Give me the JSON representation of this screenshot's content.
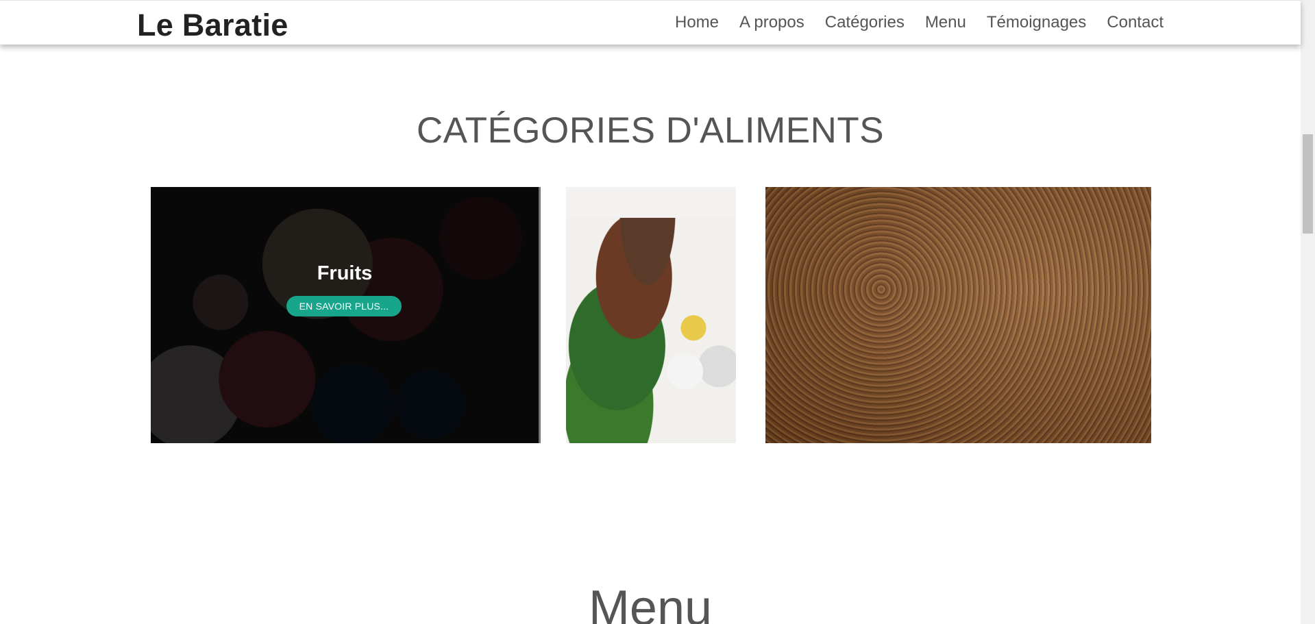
{
  "nav": {
    "brand": "Le Baratie",
    "links": [
      "Home",
      "A propos",
      "Catégories",
      "Menu",
      "Témoignages",
      "Contact"
    ]
  },
  "categories": {
    "title": "CATÉGORIES D'ALIMENTS",
    "cards": [
      {
        "title": "Fruits",
        "button": "EN SAVOIR PLUS..."
      },
      {
        "title": "",
        "button": ""
      },
      {
        "title": "",
        "button": ""
      }
    ]
  },
  "menu": {
    "title": "Menu"
  },
  "colors": {
    "accent": "#17a58b",
    "heading": "#555555",
    "brand": "#222222"
  }
}
